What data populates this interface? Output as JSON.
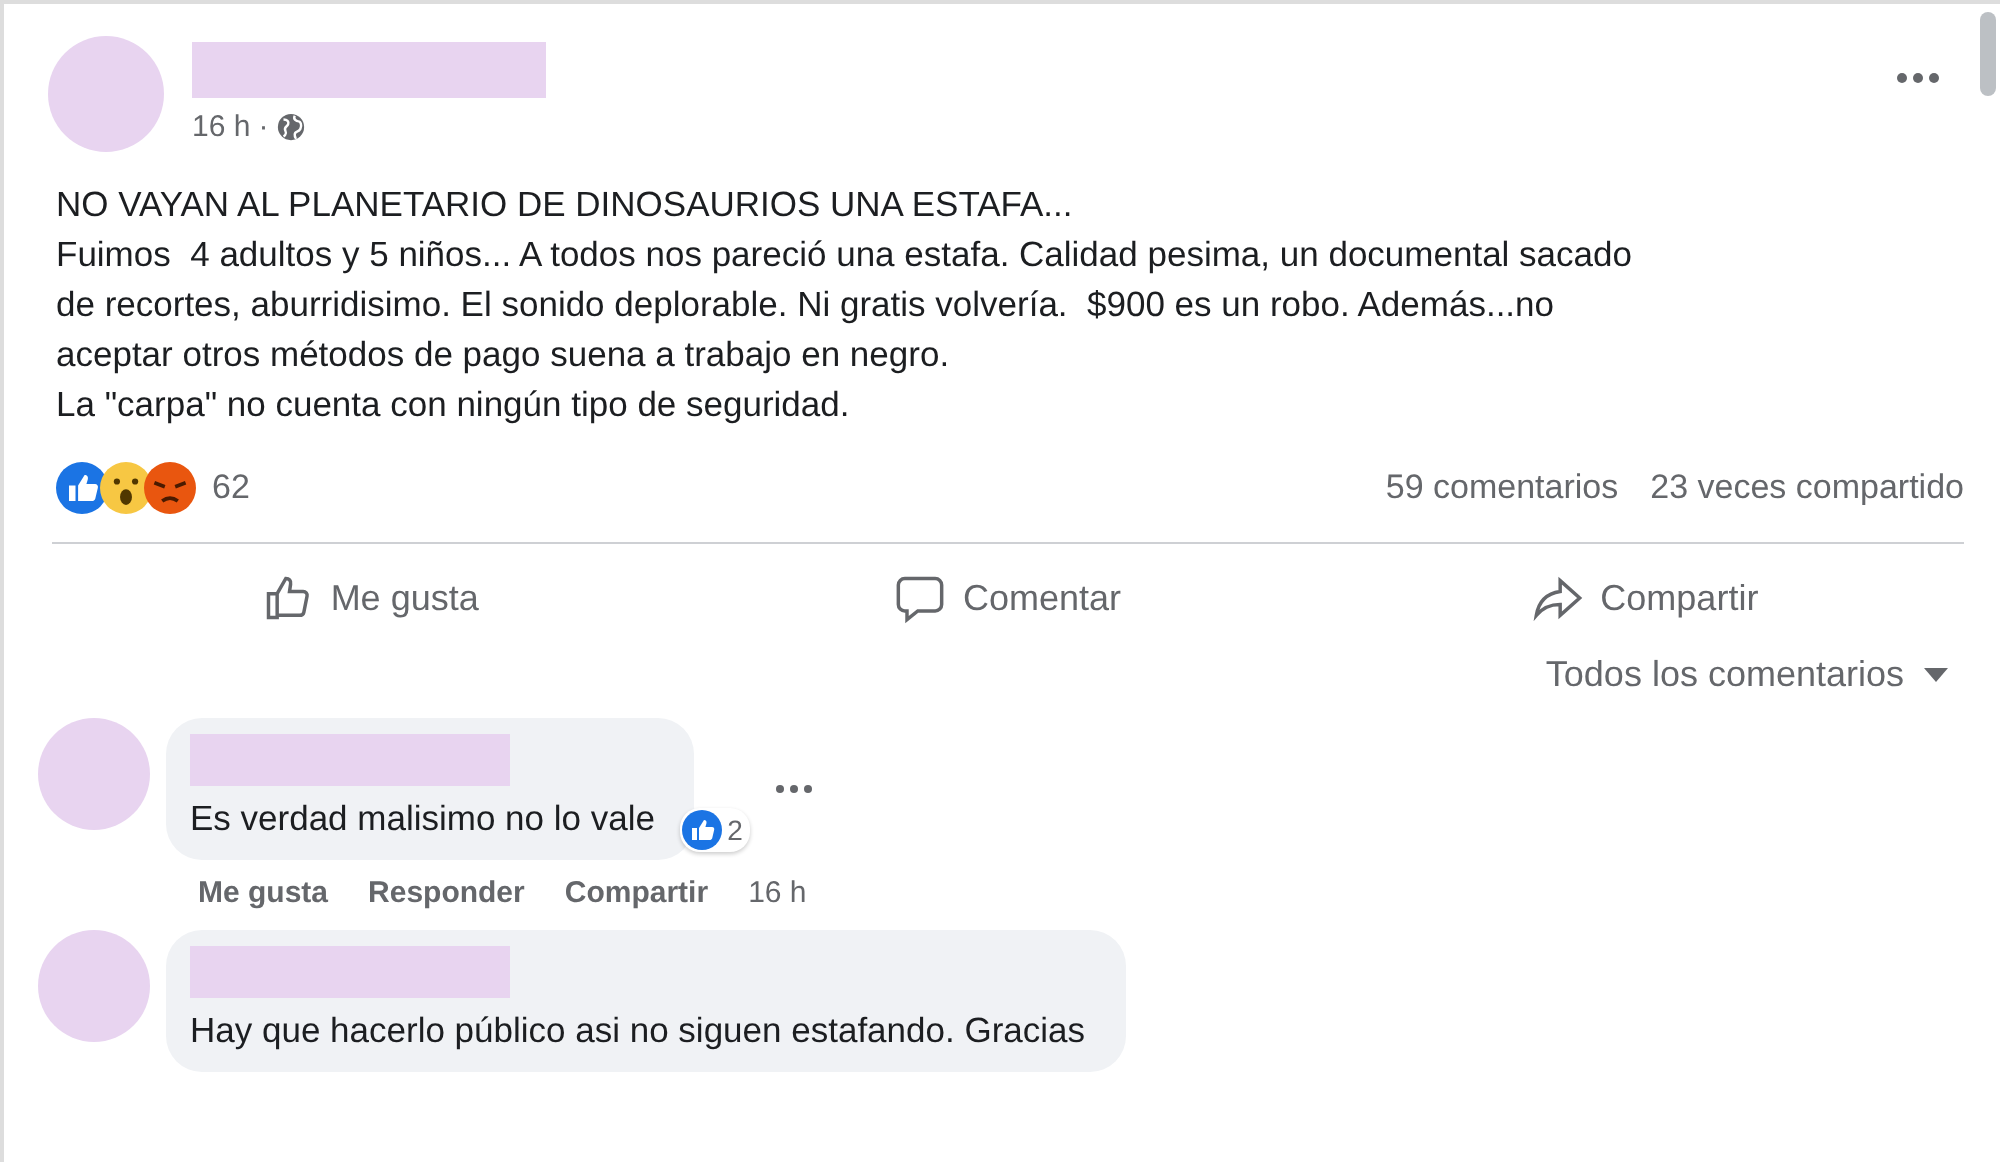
{
  "post": {
    "time": "16 h",
    "separator": "·",
    "lines": [
      "NO VAYAN AL PLANETARIO DE DINOSAURIOS UNA ESTAFA...",
      "Fuimos  4 adultos y 5 niños... A todos nos pareció una estafa. Calidad pesima, un documental sacado",
      "de recortes, aburridisimo. El sonido deplorable. Ni gratis volvería.  $900 es un robo. Además...no",
      "aceptar otros métodos de pago suena a trabajo en negro.",
      "La \"carpa\" no cuenta con ningún tipo de seguridad."
    ],
    "reaction_count": "62",
    "comments_count": "59 comentarios",
    "shares_count": "23 veces compartido"
  },
  "actions": [
    {
      "kind": "like",
      "label": "Me gusta"
    },
    {
      "kind": "comment",
      "label": "Comentar"
    },
    {
      "kind": "share",
      "label": "Compartir"
    }
  ],
  "sort": {
    "label": "Todos los comentarios"
  },
  "comments": [
    {
      "text": "Es verdad malisimo no lo vale",
      "reaction_count": "2",
      "actions": [
        "Me gusta",
        "Responder",
        "Compartir"
      ],
      "time": "16 h"
    },
    {
      "text": "Hay que hacerlo público asi no siguen estafando. Gracias"
    }
  ]
}
